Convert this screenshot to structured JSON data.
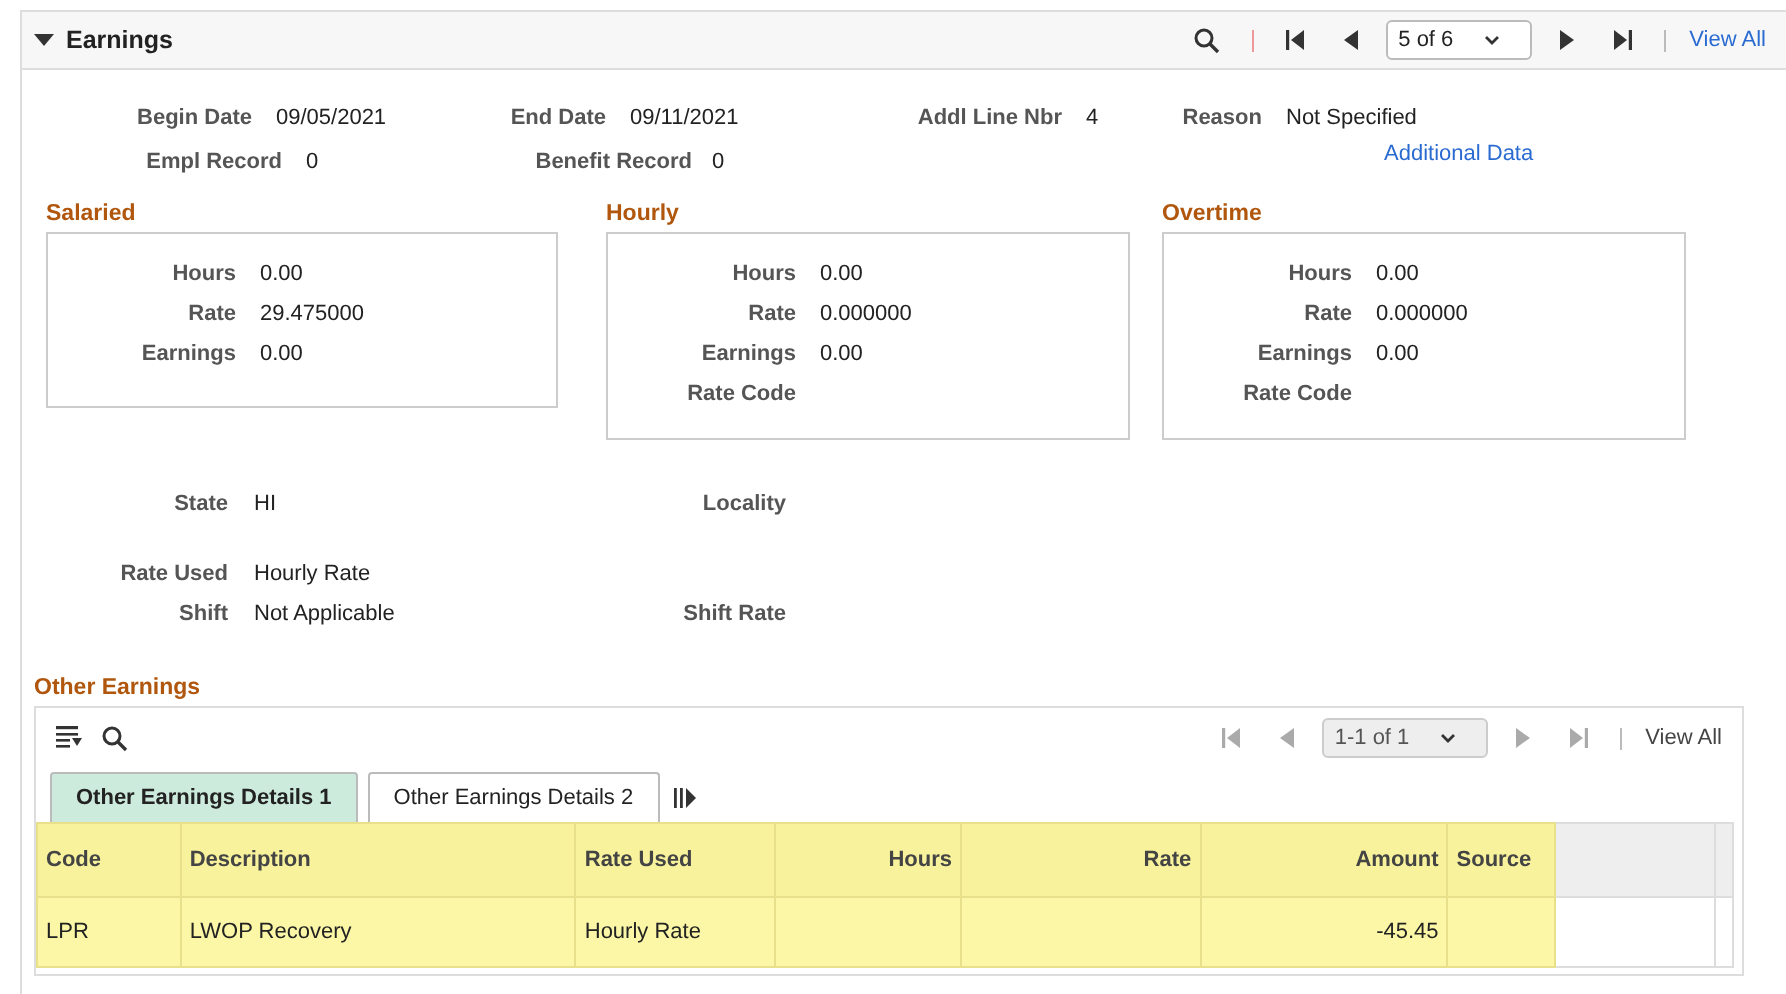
{
  "section": {
    "title": "Earnings",
    "expanded": true,
    "pager": "5 of 6",
    "view_all": "View All"
  },
  "header_fields": [
    [
      {
        "label": "Begin Date",
        "value": "09/05/2021"
      },
      {
        "label": "End Date",
        "value": "09/11/2021"
      },
      {
        "label": "Addl Line Nbr",
        "value": "4"
      },
      {
        "label": "Reason",
        "value": "Not Specified"
      }
    ],
    [
      {
        "label": "Empl Record",
        "value": "0"
      },
      {
        "label": "Benefit Record",
        "value": "0"
      }
    ]
  ],
  "additional_data_link": "Additional Data",
  "groups": [
    {
      "title": "Salaried",
      "fields": [
        {
          "label": "Hours",
          "value": "0.00"
        },
        {
          "label": "Rate",
          "value": "29.475000"
        },
        {
          "label": "Earnings",
          "value": "0.00"
        }
      ]
    },
    {
      "title": "Hourly",
      "fields": [
        {
          "label": "Hours",
          "value": "0.00"
        },
        {
          "label": "Rate",
          "value": "0.000000"
        },
        {
          "label": "Earnings",
          "value": "0.00"
        },
        {
          "label": "Rate Code"
        }
      ]
    },
    {
      "title": "Overtime",
      "fields": [
        {
          "label": "Hours",
          "value": "0.00"
        },
        {
          "label": "Rate",
          "value": "0.000000"
        },
        {
          "label": "Earnings",
          "value": "0.00"
        },
        {
          "label": "Rate Code"
        }
      ]
    }
  ],
  "location_fields": [
    [
      {
        "label": "State",
        "value": "HI"
      },
      {
        "label": "Locality"
      }
    ],
    [
      {
        "label": "Rate Used",
        "value": "Hourly Rate"
      }
    ],
    [
      {
        "label": "Shift",
        "value": "Not Applicable"
      },
      {
        "label": "Shift Rate"
      }
    ]
  ],
  "other_earnings": {
    "title": "Other Earnings",
    "pager": "1-1 of 1",
    "view_all": "View All",
    "tabs": [
      {
        "label": "Other Earnings Details 1",
        "selected": true
      },
      {
        "label": "Other Earnings Details 2",
        "selected": false
      }
    ],
    "columns": [
      {
        "label": "Code",
        "highlighted": true
      },
      {
        "label": "Description",
        "highlighted": true
      },
      {
        "label": "Rate Used",
        "highlighted": true
      },
      {
        "label": "Hours",
        "highlighted": true
      },
      {
        "label": "Rate",
        "highlighted": true
      },
      {
        "label": "Amount",
        "highlighted": true
      },
      {
        "label": "Source",
        "highlighted": true
      }
    ],
    "rows": [
      [
        "LPR",
        "LWOP Recovery",
        "Hourly Rate",
        "",
        "",
        "-45.45",
        ""
      ]
    ]
  }
}
